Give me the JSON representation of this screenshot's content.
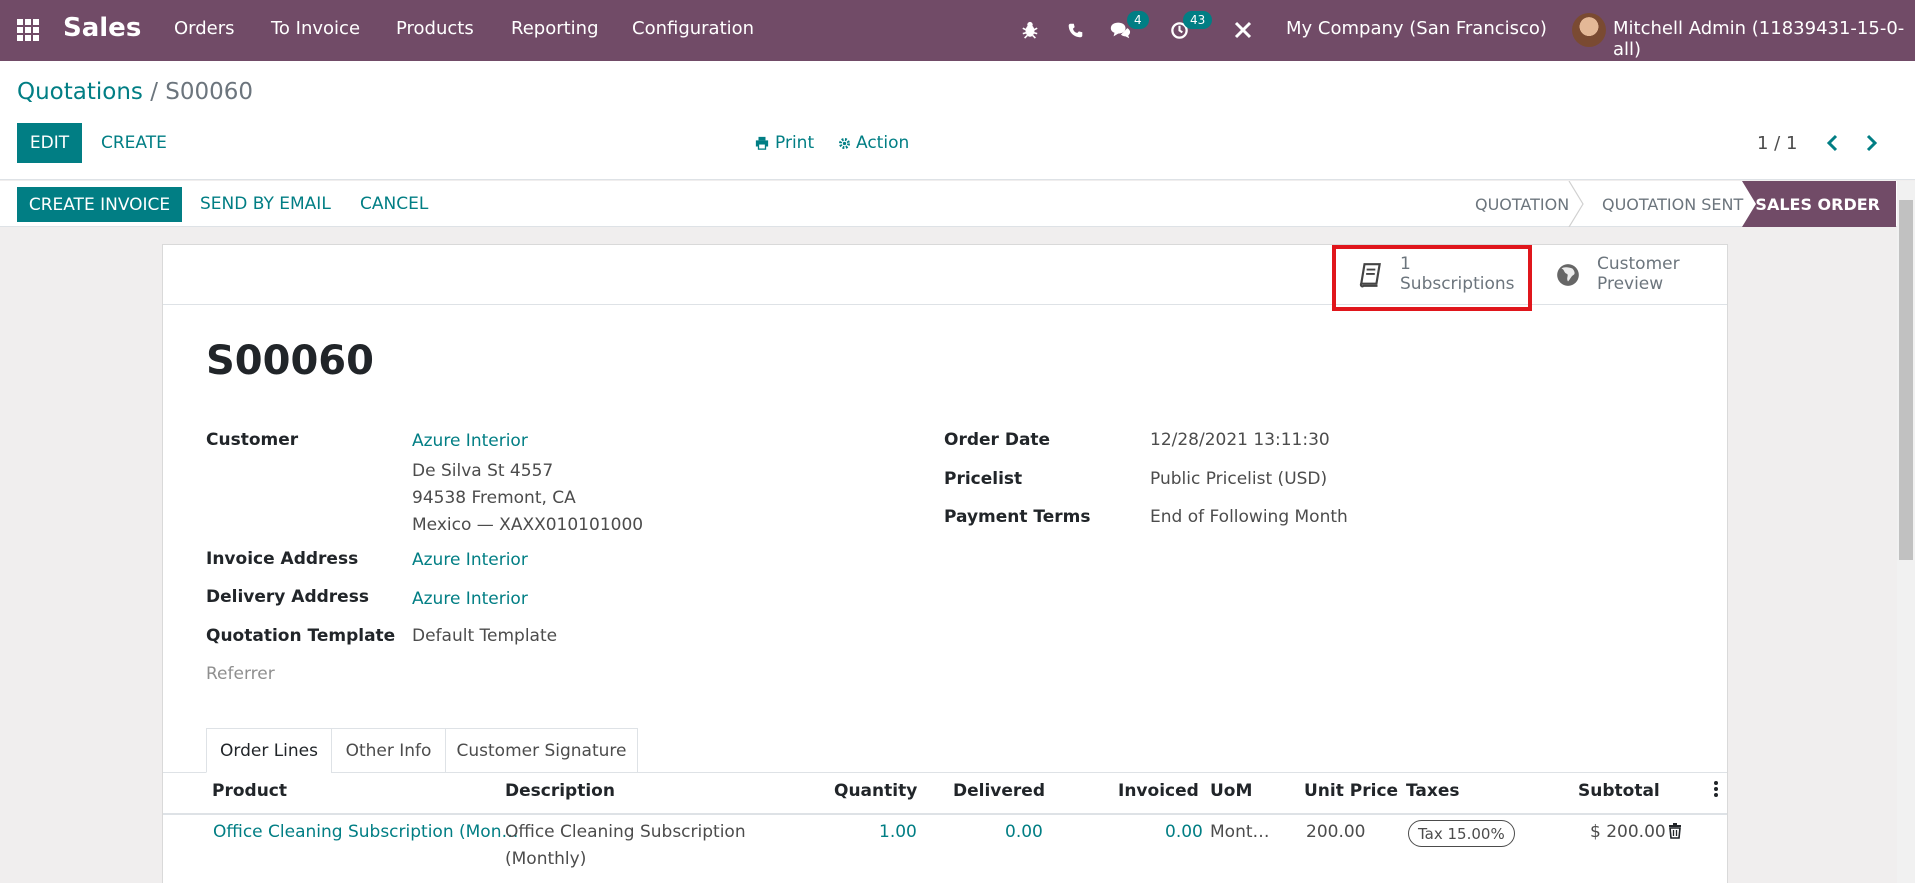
{
  "navbar": {
    "app_name": "Sales",
    "menus": [
      "Orders",
      "To Invoice",
      "Products",
      "Reporting",
      "Configuration"
    ],
    "messages_badge": "4",
    "activities_badge": "43",
    "company": "My Company (San Francisco)",
    "user": "Mitchell Admin (11839431-15-0-all)"
  },
  "breadcrumb": {
    "parent": "Quotations",
    "separator": "/",
    "current": "S00060"
  },
  "actions": {
    "edit": "EDIT",
    "create": "CREATE",
    "print": "Print",
    "action": "Action",
    "pager": "1 / 1"
  },
  "status_actions": {
    "create_invoice": "CREATE INVOICE",
    "send_by_email": "SEND BY EMAIL",
    "cancel": "CANCEL"
  },
  "stages": {
    "quotation": "QUOTATION",
    "quotation_sent": "QUOTATION SENT",
    "sales_order": "SALES ORDER",
    "active": "sales_order"
  },
  "smart_buttons": {
    "subscriptions_count": "1",
    "subscriptions_label": "Subscriptions",
    "preview_line1": "Customer",
    "preview_line2": "Preview"
  },
  "order": {
    "name": "S00060",
    "customer_label": "Customer",
    "customer_name": "Azure Interior",
    "customer_street": "De Silva St 4557",
    "customer_city": "94538 Fremont, CA",
    "customer_country": "Mexico — XAXX010101000",
    "invoice_address_label": "Invoice Address",
    "invoice_address": "Azure Interior",
    "delivery_address_label": "Delivery Address",
    "delivery_address": "Azure Interior",
    "template_label": "Quotation Template",
    "template": "Default Template",
    "referrer_label": "Referrer",
    "order_date_label": "Order Date",
    "order_date": "12/28/2021 13:11:30",
    "pricelist_label": "Pricelist",
    "pricelist": "Public Pricelist (USD)",
    "payment_terms_label": "Payment Terms",
    "payment_terms": "End of Following Month"
  },
  "tabs": [
    "Order Lines",
    "Other Info",
    "Customer Signature"
  ],
  "lines": {
    "headers": {
      "product": "Product",
      "description": "Description",
      "quantity": "Quantity",
      "delivered": "Delivered",
      "invoiced": "Invoiced",
      "uom": "UoM",
      "unit_price": "Unit Price",
      "taxes": "Taxes",
      "subtotal": "Subtotal"
    },
    "row": {
      "product": "Office Cleaning Subscription (Mon…",
      "description_1": "Office Cleaning Subscription",
      "description_2": "(Monthly)",
      "quantity": "1.00",
      "delivered": "0.00",
      "invoiced": "0.00",
      "uom": "Mont…",
      "unit_price": "200.00",
      "tax": "Tax 15.00%",
      "subtotal": "$ 200.00"
    }
  },
  "colors": {
    "brand": "#714B67",
    "accent": "#017e84",
    "highlight": "#e0161c"
  }
}
